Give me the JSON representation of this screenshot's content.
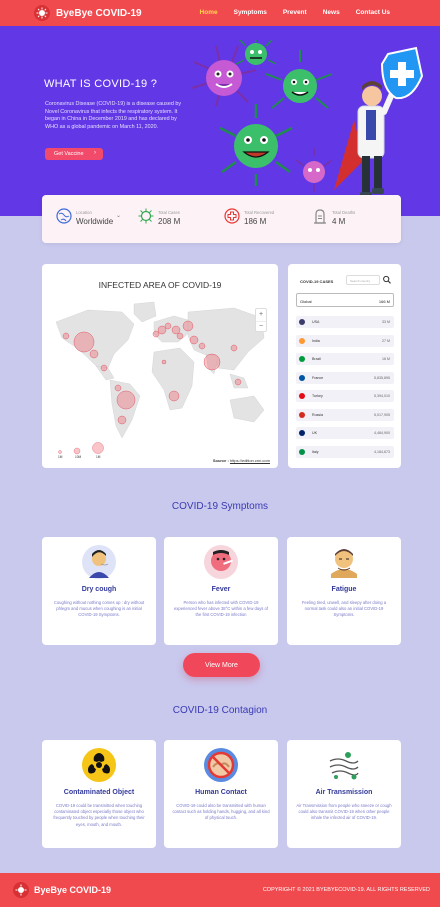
{
  "brand": {
    "name": "ByeBye COVID-19"
  },
  "nav": {
    "items": [
      {
        "label": "Home",
        "active": true
      },
      {
        "label": "Symptoms"
      },
      {
        "label": "Prevent"
      },
      {
        "label": "News"
      },
      {
        "label": "Contact Us"
      }
    ]
  },
  "hero": {
    "title": "WHAT IS COVID-19 ?",
    "text": "Coronavirus Disease (COVID-19) is a disease caused by Novel Coronavirus that infects the respiratory system. It began in China in December 2019 and has declared by WHO as a global pandemic on March 11, 2020.",
    "button": "Get Vaccine"
  },
  "stats": {
    "location": {
      "label": "Location",
      "value": "Worldwide"
    },
    "cases": {
      "label": "Total Cases",
      "value": "208 M"
    },
    "recovered": {
      "label": "Total Recovered",
      "value": "186 M"
    },
    "deaths": {
      "label": "Total Deaths",
      "value": "4 M"
    }
  },
  "map": {
    "title": "INFECTED AREA OF COVID-19",
    "zoom_in": "+",
    "zoom_out": "−",
    "source_label": "Source :",
    "source_link": "https://edition.cnn.com",
    "legend": [
      "1M",
      "10M",
      "1M"
    ]
  },
  "cases_panel": {
    "title": "COVID-19 CASES",
    "search_placeholder": "Search country",
    "global": {
      "name": "Global",
      "value": "166 M"
    },
    "countries": [
      {
        "name": "USA",
        "value": "33 M",
        "flag": "#3c3b6e"
      },
      {
        "name": "India",
        "value": "27 M",
        "flag": "#ff9933"
      },
      {
        "name": "Brazil",
        "value": "16 M",
        "flag": "#009c3b"
      },
      {
        "name": "France",
        "value": "5,835,895",
        "flag": "#0055a4"
      },
      {
        "name": "Turkey",
        "value": "5,394,010",
        "flag": "#e30a17"
      },
      {
        "name": "Russia",
        "value": "5,017,905",
        "flag": "#d52b1e"
      },
      {
        "name": "UK",
        "value": "4,484,900",
        "flag": "#012169"
      },
      {
        "name": "Italy",
        "value": "4,184,673",
        "flag": "#009246"
      }
    ]
  },
  "symptoms": {
    "title": "COVID-19 Symptoms",
    "items": [
      {
        "title": "Dry cough",
        "text": "Coughing without nothing comes up : dry without phlegm and mucus when coughing is an initial COVID-19 Symptoms."
      },
      {
        "title": "Fever",
        "text": "Person who has infected with COVID-19 experienced fever above 38°C within a few days of the first COVID-19 infection"
      },
      {
        "title": "Fatigue",
        "text": "Feeling tired, unwell, and sleepy after doing a normal task could also an initial COVID-19 Symptoms."
      }
    ],
    "more_button": "View More"
  },
  "contagion": {
    "title": "COVID-19 Contagion",
    "items": [
      {
        "title": "Contaminated Object",
        "text": "COVID-19 could be transmitted when touching contaminated object especially those object who frequently touched by people when touching their eyes, mouth, and mouth."
      },
      {
        "title": "Human Contact",
        "text": "COVID-19 could also be transmitted with human contact such as holding hands, hugging, and all kind of physical touch."
      },
      {
        "title": "Air Transmission",
        "text": "Air Transmission from people who sneeze or cough could also transmit COVID-19 when other people inhale the infected air of COVID-19."
      }
    ]
  },
  "footer": {
    "brand": "ByeBye COVID-19",
    "copyright": "COPYRIGHT © 2021 BYEBYECOVID-19. ALL RIGHTS RESERVED"
  },
  "colors": {
    "primary": "#f04a4f",
    "hero": "#6238e6",
    "background": "#c9c9ee",
    "heading": "#3a3ab3"
  }
}
